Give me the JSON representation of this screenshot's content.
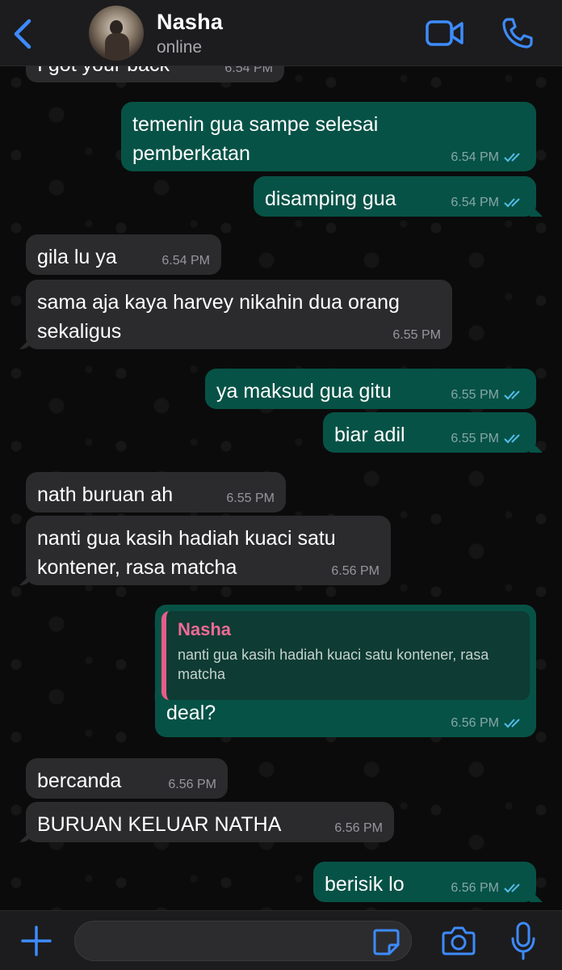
{
  "header": {
    "contact_name": "Nasha",
    "status": "online"
  },
  "colors": {
    "accent": "#3d8bfd",
    "outgoing_bubble": "#075246",
    "incoming_bubble": "#2b2b2d",
    "quote_name": "#f06a96",
    "read_ticks": "#53bdeb"
  },
  "icons": [
    "back-chevron-icon",
    "video-call-icon",
    "phone-icon",
    "plus-icon",
    "sticker-icon",
    "camera-icon",
    "mic-icon"
  ],
  "messages": [
    {
      "dir": "in",
      "text": "I got your back",
      "time": "6.54 PM"
    },
    {
      "dir": "out",
      "text": "temenin gua sampe selesai pemberkatan",
      "time": "6.54 PM"
    },
    {
      "dir": "out",
      "text": "disamping gua",
      "time": "6.54 PM"
    },
    {
      "dir": "in",
      "text": "gila lu ya",
      "time": "6.54 PM"
    },
    {
      "dir": "in",
      "text": "sama aja kaya harvey nikahin dua orang sekaligus",
      "time": "6.55 PM"
    },
    {
      "dir": "out",
      "text": "ya maksud gua gitu",
      "time": "6.55 PM"
    },
    {
      "dir": "out",
      "text": "biar adil",
      "time": "6.55 PM"
    },
    {
      "dir": "in",
      "text": "nath buruan ah",
      "time": "6.55 PM"
    },
    {
      "dir": "in",
      "text": "nanti gua kasih hadiah kuaci satu kontener, rasa matcha",
      "time": "6.56 PM"
    },
    {
      "dir": "out",
      "text": "deal?",
      "time": "6.56 PM",
      "quote": {
        "name": "Nasha",
        "text": "nanti gua kasih hadiah kuaci satu kontener, rasa matcha"
      }
    },
    {
      "dir": "in",
      "text": "bercanda",
      "time": "6.56 PM"
    },
    {
      "dir": "in",
      "text": "BURUAN KELUAR NATHA",
      "time": "6.56 PM"
    },
    {
      "dir": "out",
      "text": "berisik lo",
      "time": "6.56 PM"
    }
  ],
  "input": {
    "placeholder": ""
  }
}
